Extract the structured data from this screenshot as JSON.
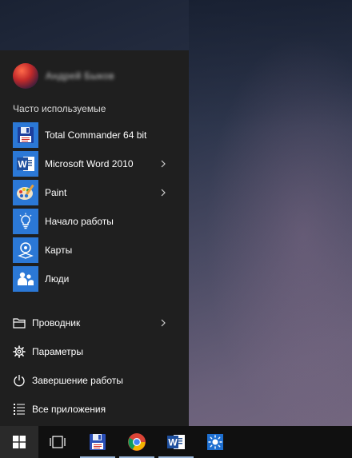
{
  "user": {
    "name": "Андрей Быков"
  },
  "start_menu": {
    "section_header": "Часто используемые",
    "apps": [
      {
        "label": "Total Commander 64 bit",
        "icon": "floppy-disk-icon",
        "has_submenu": false
      },
      {
        "label": "Microsoft Word 2010",
        "icon": "word-icon",
        "has_submenu": true
      },
      {
        "label": "Paint",
        "icon": "paint-palette-icon",
        "has_submenu": true
      },
      {
        "label": "Начало работы",
        "icon": "lightbulb-icon",
        "has_submenu": false
      },
      {
        "label": "Карты",
        "icon": "map-pin-icon",
        "has_submenu": false
      },
      {
        "label": "Люди",
        "icon": "people-icon",
        "has_submenu": false
      }
    ],
    "system": [
      {
        "label": "Проводник",
        "icon": "folder-icon",
        "has_submenu": true
      },
      {
        "label": "Параметры",
        "icon": "gear-icon",
        "has_submenu": false
      },
      {
        "label": "Завершение работы",
        "icon": "power-icon",
        "has_submenu": false
      },
      {
        "label": "Все приложения",
        "icon": "all-apps-icon",
        "has_submenu": false
      }
    ]
  },
  "taskbar": {
    "items": [
      "windows-logo-icon",
      "task-view-icon",
      "floppy-disk-icon",
      "chrome-icon",
      "word-icon",
      "brightness-icon"
    ]
  },
  "colors": {
    "accent": "#2b78d6",
    "menu_bg": "#1f1f1f",
    "taskbar_bg": "#101010"
  }
}
